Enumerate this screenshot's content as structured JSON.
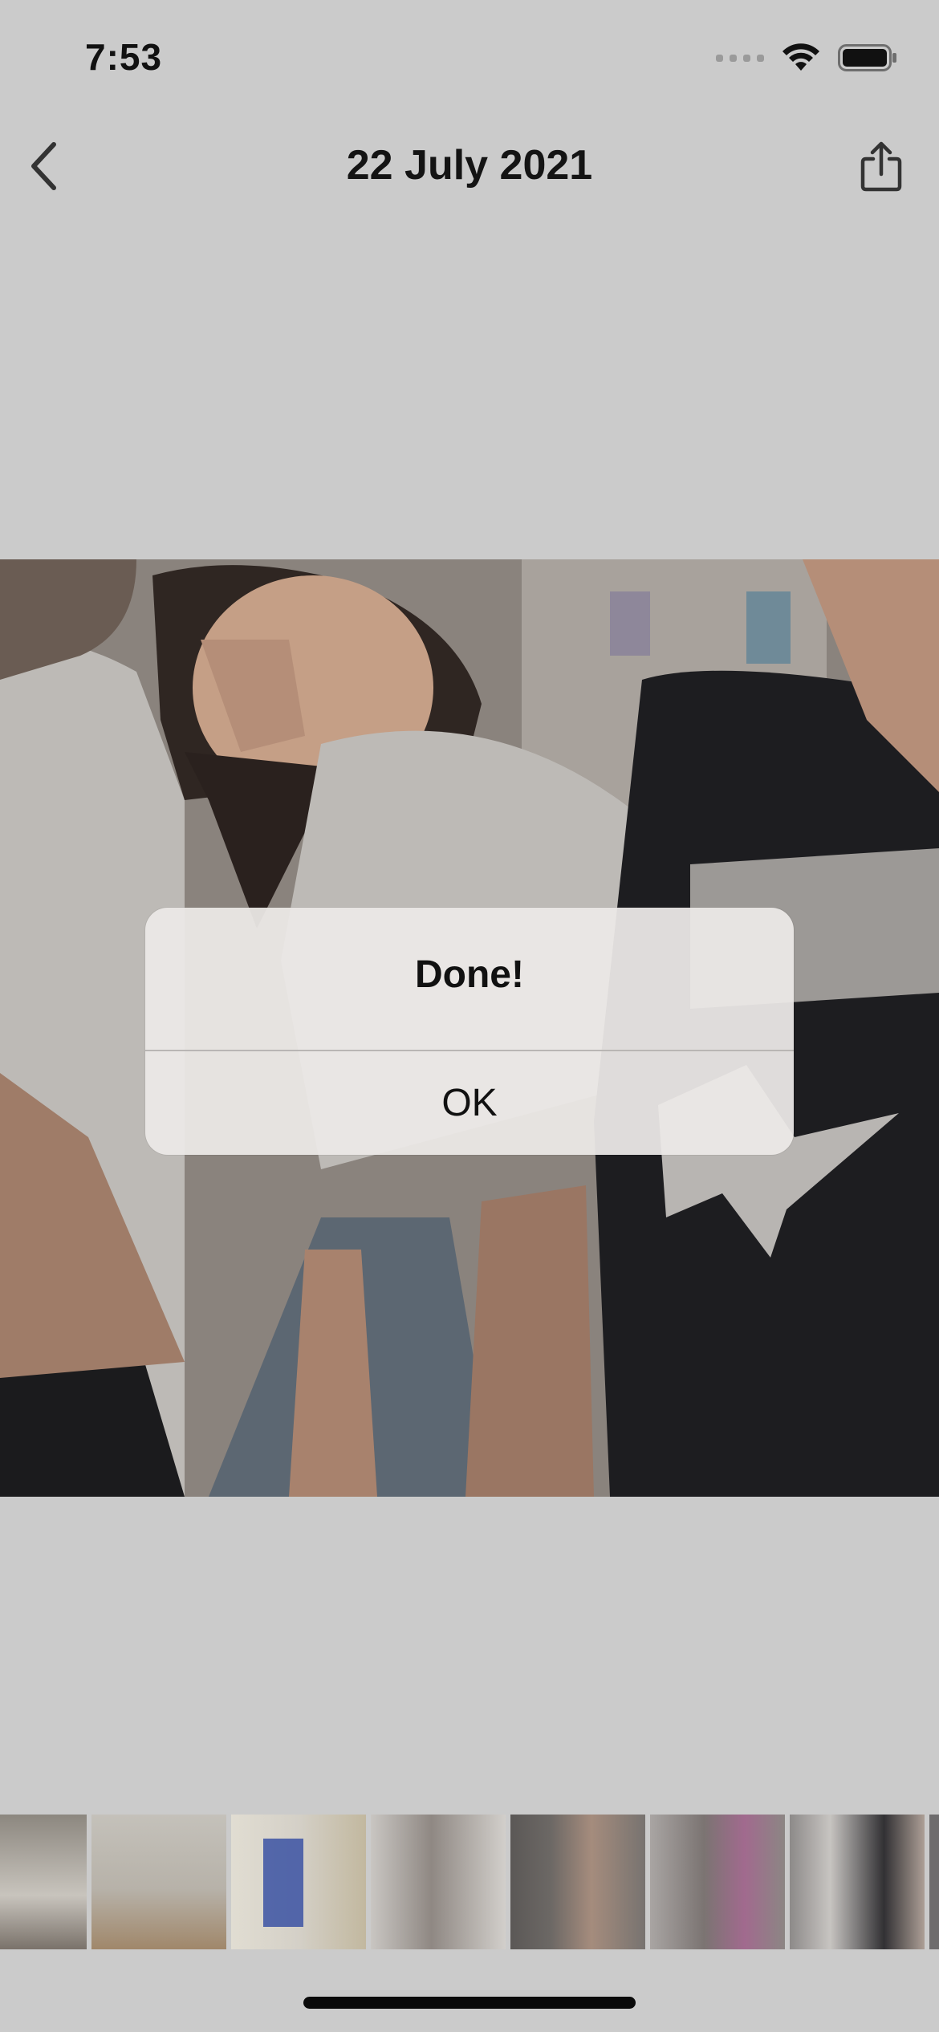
{
  "status_bar": {
    "time": "7:53",
    "icons": [
      "cellular-signal-icon",
      "wifi-icon",
      "battery-icon"
    ]
  },
  "nav": {
    "back_icon": "chevron-left-icon",
    "title": "22 July 2021",
    "share_icon": "share-icon"
  },
  "photo": {
    "description_icon": "photo-image"
  },
  "alert": {
    "title": "Done!",
    "ok_label": "OK"
  },
  "thumbnails": {
    "count": 7,
    "colors": [
      "#7f7b76",
      "#a8a49c",
      "#d9d6cc",
      "#8b8985",
      "#5f5c5a",
      "#807d80",
      "#6d6b6c"
    ]
  },
  "colors": {
    "background": "#cbcbcb",
    "alert_background": "#ece9e7",
    "text": "#111111"
  }
}
